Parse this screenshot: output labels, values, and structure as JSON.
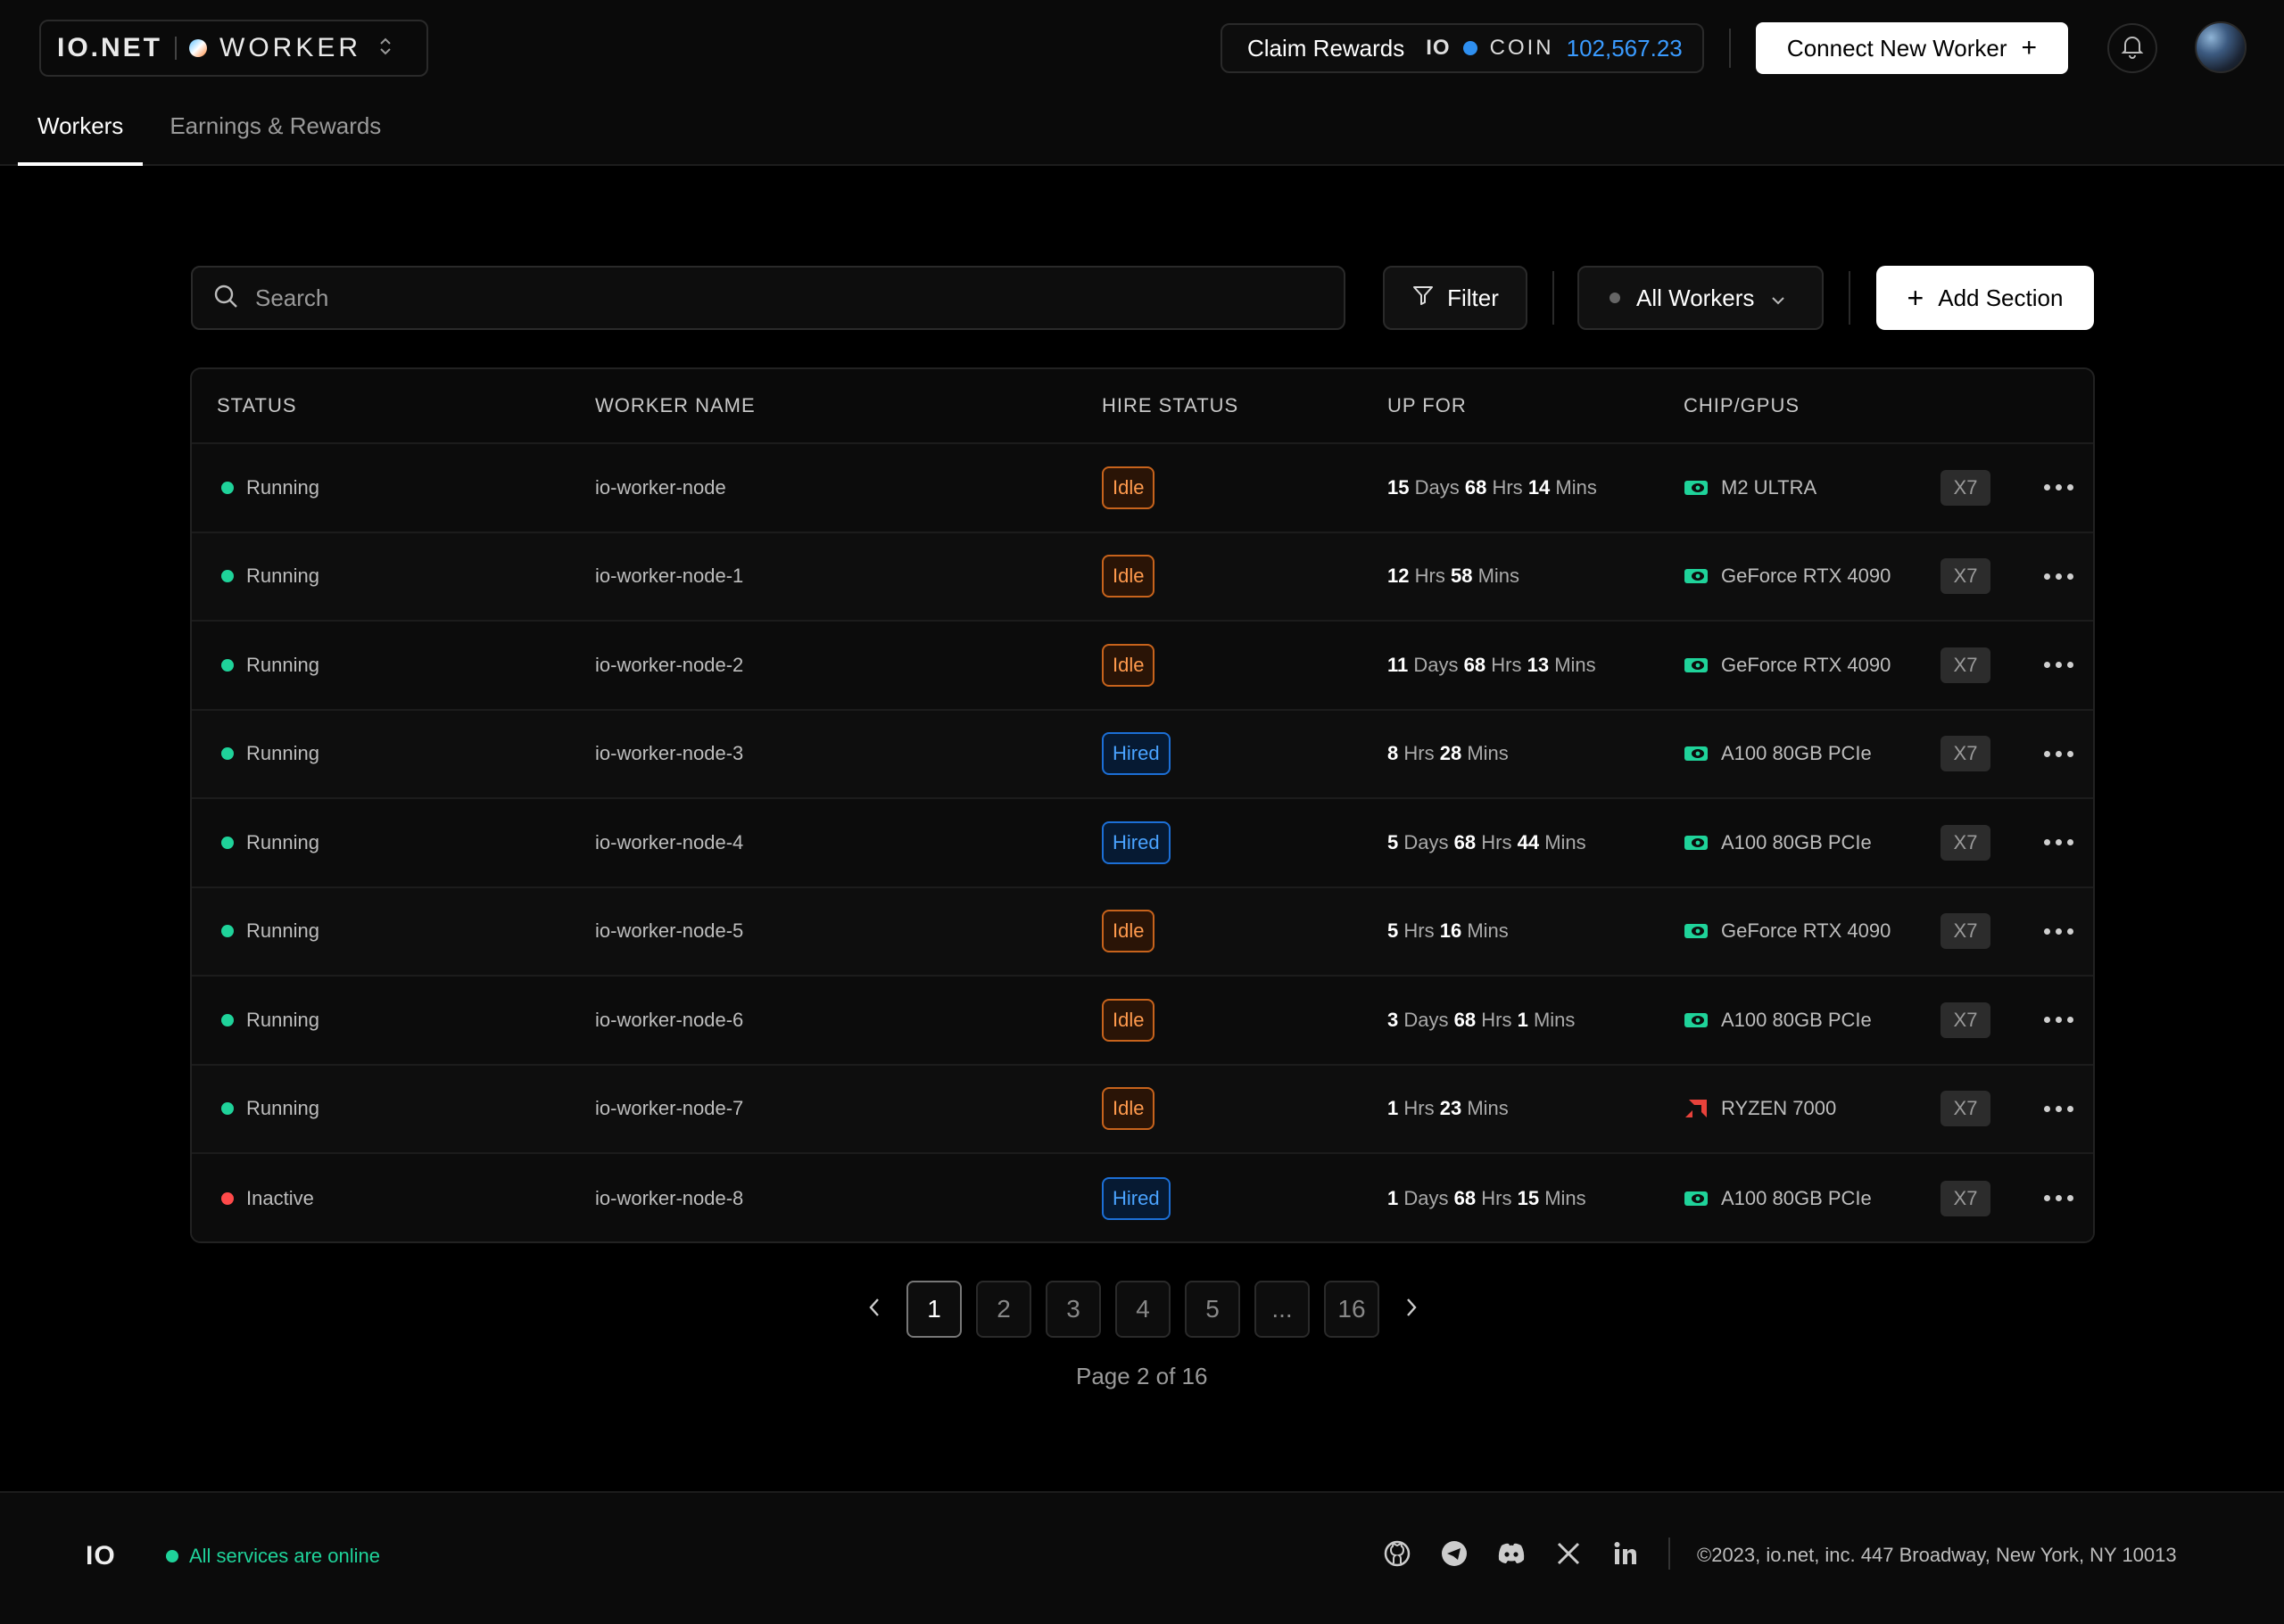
{
  "header": {
    "brand_logo": "IO.NET",
    "brand_product": "WORKER",
    "claim_label": "Claim Rewards",
    "coin_logo": "IO",
    "coin_label": "COIN",
    "coin_amount": "102,567.23",
    "connect_label": "Connect New Worker",
    "tabs": [
      {
        "label": "Workers",
        "active": true
      },
      {
        "label": "Earnings & Rewards",
        "active": false
      }
    ]
  },
  "toolbar": {
    "search_placeholder": "Search",
    "filter_label": "Filter",
    "workers_select": "All Workers",
    "add_section_label": "Add Section"
  },
  "table": {
    "columns": [
      "STATUS",
      "WORKER NAME",
      "HIRE STATUS",
      "UP FOR",
      "CHIP/GPUS"
    ],
    "rows": [
      {
        "status": "Running",
        "name": "io-worker-node",
        "hire": "Idle",
        "up": [
          [
            "15",
            "Days"
          ],
          [
            "68",
            "Hrs"
          ],
          [
            "14",
            "Mins"
          ]
        ],
        "chip": "M2 ULTRA",
        "vendor": "nvidia",
        "count": "X7"
      },
      {
        "status": "Running",
        "name": "io-worker-node-1",
        "hire": "Idle",
        "up": [
          [
            "12",
            "Hrs"
          ],
          [
            "58",
            "Mins"
          ]
        ],
        "chip": "GeForce RTX 4090",
        "vendor": "nvidia",
        "count": "X7"
      },
      {
        "status": "Running",
        "name": "io-worker-node-2",
        "hire": "Idle",
        "up": [
          [
            "11",
            "Days"
          ],
          [
            "68",
            "Hrs"
          ],
          [
            "13",
            "Mins"
          ]
        ],
        "chip": "GeForce RTX 4090",
        "vendor": "nvidia",
        "count": "X7"
      },
      {
        "status": "Running",
        "name": "io-worker-node-3",
        "hire": "Hired",
        "up": [
          [
            "8",
            "Hrs"
          ],
          [
            "28",
            "Mins"
          ]
        ],
        "chip": "A100 80GB PCIe",
        "vendor": "nvidia",
        "count": "X7"
      },
      {
        "status": "Running",
        "name": "io-worker-node-4",
        "hire": "Hired",
        "up": [
          [
            "5",
            "Days"
          ],
          [
            "68",
            "Hrs"
          ],
          [
            "44",
            "Mins"
          ]
        ],
        "chip": "A100 80GB PCIe",
        "vendor": "nvidia",
        "count": "X7"
      },
      {
        "status": "Running",
        "name": "io-worker-node-5",
        "hire": "Idle",
        "up": [
          [
            "5",
            "Hrs"
          ],
          [
            "16",
            "Mins"
          ]
        ],
        "chip": "GeForce RTX 4090",
        "vendor": "nvidia",
        "count": "X7"
      },
      {
        "status": "Running",
        "name": "io-worker-node-6",
        "hire": "Idle",
        "up": [
          [
            "3",
            "Days"
          ],
          [
            "68",
            "Hrs"
          ],
          [
            "1",
            "Mins"
          ]
        ],
        "chip": "A100 80GB PCIe",
        "vendor": "nvidia",
        "count": "X7"
      },
      {
        "status": "Running",
        "name": "io-worker-node-7",
        "hire": "Idle",
        "up": [
          [
            "1",
            "Hrs"
          ],
          [
            "23",
            "Mins"
          ]
        ],
        "chip": "RYZEN 7000",
        "vendor": "amd",
        "count": "X7"
      },
      {
        "status": "Inactive",
        "name": "io-worker-node-8",
        "hire": "Hired",
        "up": [
          [
            "1",
            "Days"
          ],
          [
            "68",
            "Hrs"
          ],
          [
            "15",
            "Mins"
          ]
        ],
        "chip": "A100 80GB PCIe",
        "vendor": "nvidia",
        "count": "X7"
      }
    ]
  },
  "pagination": {
    "pages": [
      "1",
      "2",
      "3",
      "4",
      "5",
      "...",
      "16"
    ],
    "active": "1",
    "info": "Page 2 of 16"
  },
  "footer": {
    "logo": "IO",
    "status": "All services are online",
    "socials": [
      "github-icon",
      "telegram-icon",
      "discord-icon",
      "x-icon",
      "linkedin-icon"
    ],
    "copyright": "©2023, io.net, inc. 447 Broadway, New York, NY 10013"
  },
  "colors": {
    "running": "#1fd39a",
    "inactive": "#ff4a4a",
    "idle": "#ff9a4d",
    "hired": "#4aa3ff",
    "coin": "#3a9bff",
    "nvidia": "#1fd39a",
    "amd": "#e8423b"
  }
}
